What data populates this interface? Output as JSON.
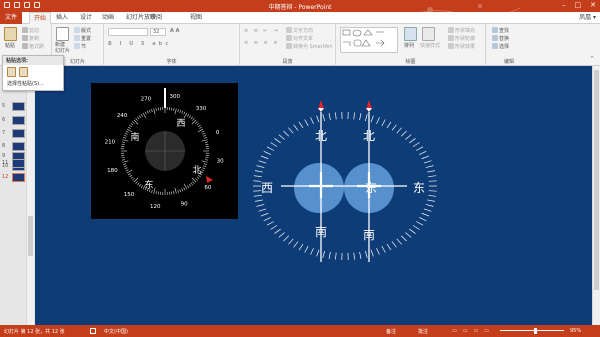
{
  "window": {
    "title": "中期答辩 - PowerPoint",
    "user": "凤凰 ▾",
    "min": "–",
    "max": "□",
    "close": "✕"
  },
  "tabs": [
    "文件",
    "开始",
    "插入",
    "设计",
    "动画",
    "幻灯片放映",
    "审阅",
    "视图"
  ],
  "active_tab": "开始",
  "ribbon": {
    "clipboard": {
      "paste": "粘贴",
      "cut": "剪切",
      "copy": "复制",
      "format_painter": "格式刷",
      "group": ""
    },
    "slides": {
      "new_slide": "新建\n幻灯片",
      "layout": "版式",
      "reset": "重置",
      "section": "节",
      "group": "幻灯片"
    },
    "font": {
      "size": "32",
      "group": "字体"
    },
    "paragraph": {
      "text_direction": "文字方向",
      "align_text": "对齐文本",
      "smartart": "转换为 SmartArt",
      "group": "段落"
    },
    "drawing": {
      "arrange": "排列",
      "quick_styles": "快速样式",
      "shape_fill": "形状填充",
      "shape_outline": "形状轮廓",
      "shape_effects": "形状效果",
      "group": "绘图"
    },
    "editing": {
      "find": "查找",
      "replace": "替换",
      "select": "选择",
      "group": "编辑"
    }
  },
  "paste_menu": {
    "header": "粘贴选项:",
    "special": "选择性粘贴(S)..."
  },
  "thumbnails": [
    "5",
    "6",
    "7",
    "8",
    "9",
    "10",
    "11",
    "12"
  ],
  "active_slide": "12",
  "compass": {
    "degrees": [
      "0",
      "30",
      "60",
      "90",
      "120",
      "150",
      "180",
      "210",
      "240",
      "270",
      "300",
      "330"
    ],
    "south": "南",
    "west": "西",
    "east": "东",
    "north": "北"
  },
  "diagram": {
    "north_left": "北",
    "north_right": "北",
    "south_left": "南",
    "south_right": "南",
    "west": "西",
    "east_mid": "东",
    "east": "东"
  },
  "status": {
    "slide_info": "幻灯片 第 12 张，共 12 张",
    "language": "中文(中国)",
    "notes": "备注",
    "comments": "批注",
    "zoom": "95%"
  }
}
